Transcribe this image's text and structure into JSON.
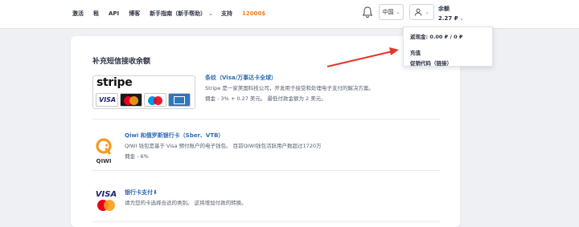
{
  "nav": {
    "items": [
      "激活",
      "租",
      "API",
      "博客",
      "新手指南（新手帮助）",
      "支持"
    ],
    "promo": "12000$"
  },
  "header": {
    "language": "中国",
    "balance_label": "余额",
    "balance_value": "2.27 ₽"
  },
  "dropdown": {
    "cashback": "返现金: 0.00 ₽ / 0 ₽",
    "topup": "充值",
    "promo_code": "促销代码（链接）"
  },
  "page": {
    "title": "补充短信接收余额"
  },
  "methods": [
    {
      "logo": "stripe-logo",
      "logo_text": "stripe",
      "card_logos": [
        "VISA",
        "MasterCard",
        "Maestro",
        "AmericanExpress"
      ],
      "title": "条纹（Visa/万事达卡全球）",
      "desc": "Stripe 是一家美国科技公司，开发用于接受和处理电子支付的解决方案。",
      "fee": "佣金 - 3% + 0.27 美元。 最低付款金额为 2 美元。"
    },
    {
      "logo": "qiwi-logo",
      "logo_text": "QIWI",
      "title": "Qiwi 和俄罗斯银行卡（Sber、VTB）",
      "desc": "QIWI 钱包是基于 Visa 预付账户的电子钱包。 目前QIWI钱包活跃用户数超过1720万",
      "fee": "佣金 - 6%"
    },
    {
      "logo": "visa-mastercard-logo",
      "logo_text": "VISA",
      "title": "银行卡支付⬇",
      "desc": "请为您的卡选择合适的类别。 这将增加付款的转换。"
    }
  ],
  "colors": {
    "accent_orange": "#f47b20",
    "arrow_red": "#e8332a",
    "link_blue": "#2f6bb3"
  }
}
